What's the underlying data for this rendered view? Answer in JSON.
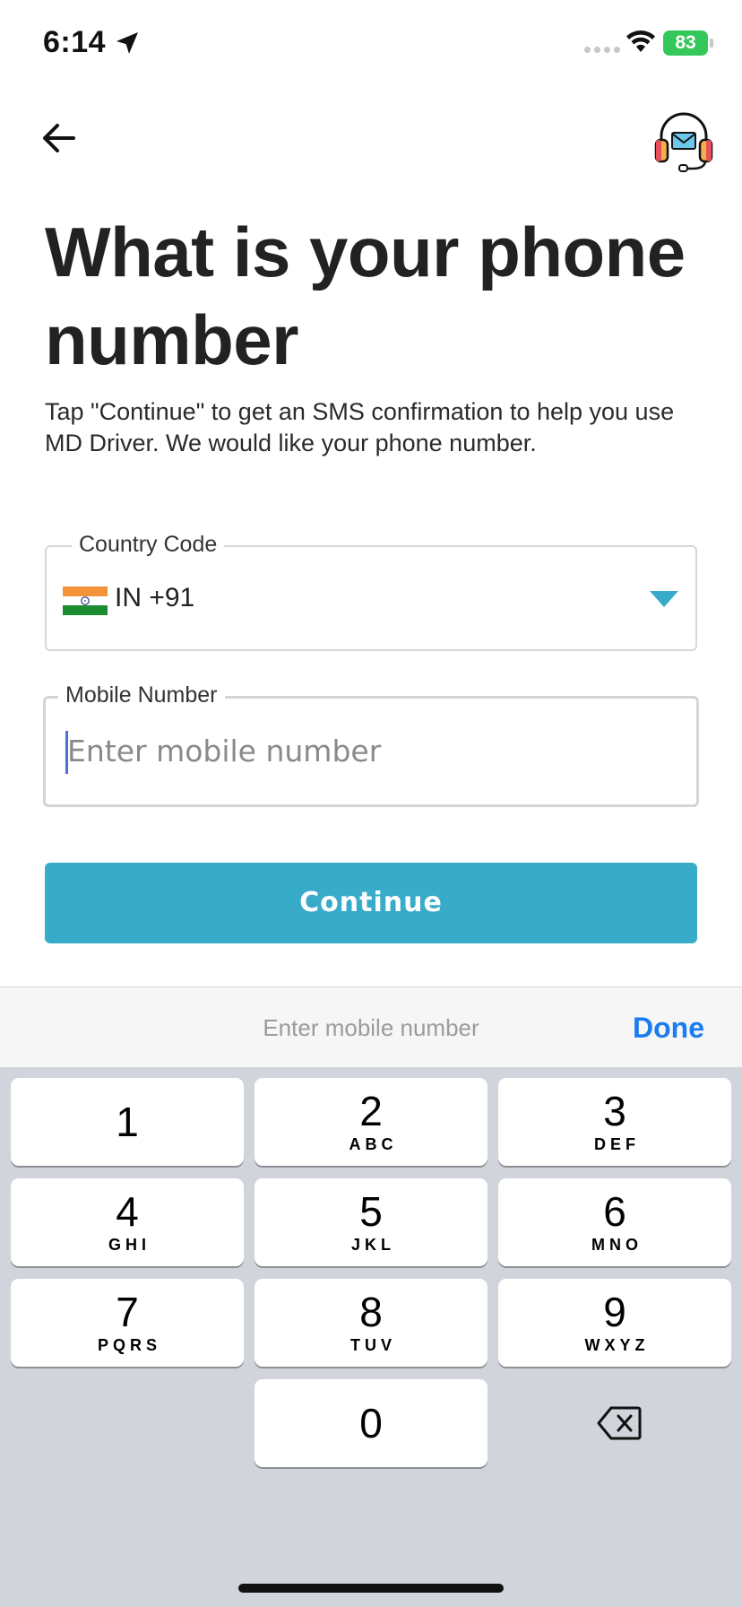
{
  "status_bar": {
    "time": "6:14",
    "battery": "83"
  },
  "header": {
    "back_icon": "arrow-left-icon",
    "support_icon": "headset-support-icon"
  },
  "title": "What is your phone number",
  "subtitle": "Tap \"Continue\" to get an SMS confirmation to help you use MD Driver. We would like your phone number.",
  "country_field": {
    "label": "Country Code",
    "value": "IN +91",
    "flag": "india-flag-icon"
  },
  "mobile_field": {
    "label": "Mobile Number",
    "placeholder": "Enter mobile number",
    "value": ""
  },
  "continue_label": "Continue",
  "keyboard": {
    "accessory_placeholder": "Enter mobile number",
    "done_label": "Done",
    "keys": [
      {
        "digit": "1",
        "letters": ""
      },
      {
        "digit": "2",
        "letters": "ABC"
      },
      {
        "digit": "3",
        "letters": "DEF"
      },
      {
        "digit": "4",
        "letters": "GHI"
      },
      {
        "digit": "5",
        "letters": "JKL"
      },
      {
        "digit": "6",
        "letters": "MNO"
      },
      {
        "digit": "7",
        "letters": "PQRS"
      },
      {
        "digit": "8",
        "letters": "TUV"
      },
      {
        "digit": "9",
        "letters": "WXYZ"
      },
      {
        "digit": "0",
        "letters": ""
      }
    ]
  },
  "colors": {
    "accent": "#38abc8",
    "done": "#1a7cf0",
    "battery": "#34c759",
    "keyboard_bg": "#d1d4db"
  }
}
